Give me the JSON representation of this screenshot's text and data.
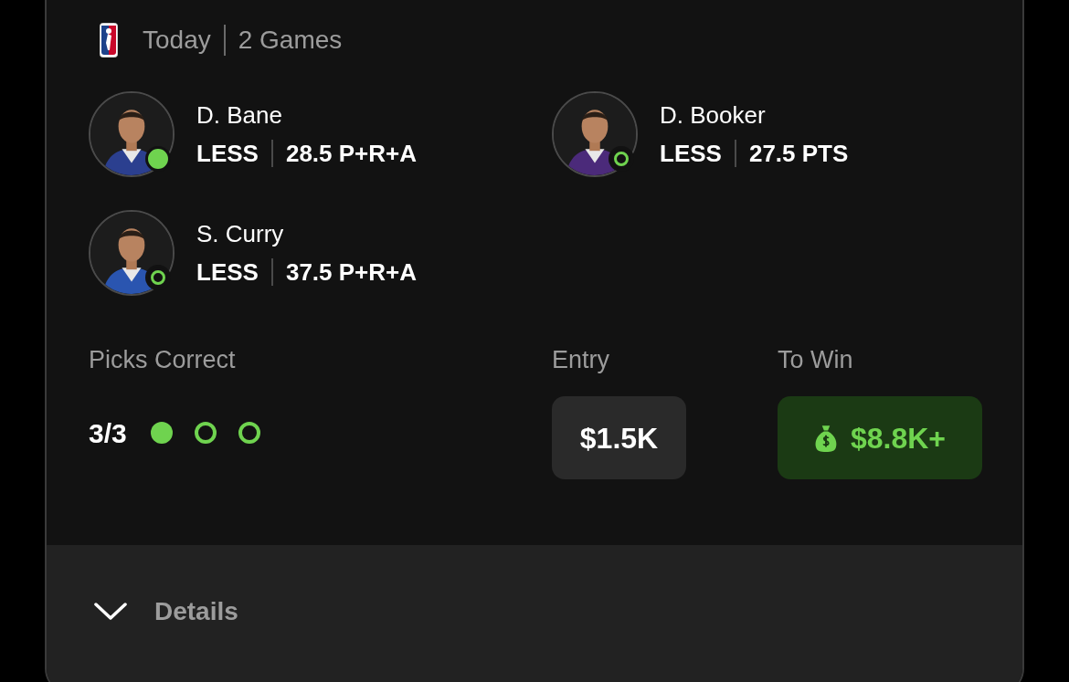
{
  "header": {
    "day": "Today",
    "games": "2 Games"
  },
  "players": [
    {
      "name": "D. Bane",
      "pick": "LESS",
      "line": "28.5 P+R+A",
      "hit": true
    },
    {
      "name": "D. Booker",
      "pick": "LESS",
      "line": "27.5 PTS",
      "hit": false
    },
    {
      "name": "S. Curry",
      "pick": "LESS",
      "line": "37.5 P+R+A",
      "hit": false
    }
  ],
  "summary": {
    "picks_label": "Picks Correct",
    "picks_value": "3/3",
    "pick_dots": [
      {
        "hit": true
      },
      {
        "hit": false
      },
      {
        "hit": false
      }
    ],
    "entry_label": "Entry",
    "entry_value": "$1.5K",
    "win_label": "To Win",
    "win_value": "$8.8K+"
  },
  "details": {
    "label": "Details",
    "expanded": false
  }
}
